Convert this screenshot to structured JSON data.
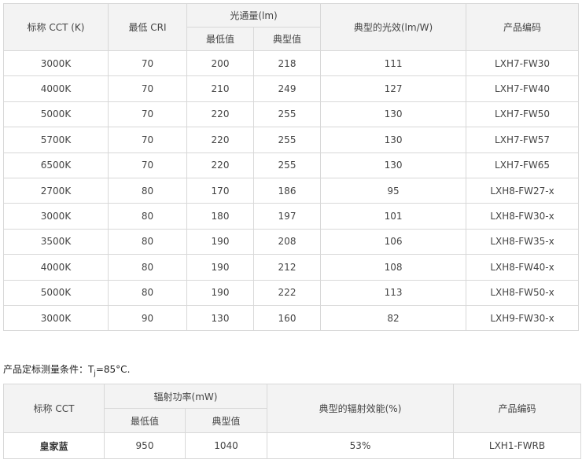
{
  "table1": {
    "headers": {
      "cct": "标称 CCT (K)",
      "min_cri": "最低 CRI",
      "flux_group": "光通量(lm)",
      "flux_min": "最低值",
      "flux_typ": "典型值",
      "efficacy": "典型的光效(lm/W)",
      "code": "产品编码"
    },
    "rows": [
      {
        "cct": "3000K",
        "cri": "70",
        "min": "200",
        "typ": "218",
        "eff": "111",
        "code": "LXH7-FW30"
      },
      {
        "cct": "4000K",
        "cri": "70",
        "min": "210",
        "typ": "249",
        "eff": "127",
        "code": "LXH7-FW40"
      },
      {
        "cct": "5000K",
        "cri": "70",
        "min": "220",
        "typ": "255",
        "eff": "130",
        "code": "LXH7-FW50"
      },
      {
        "cct": "5700K",
        "cri": "70",
        "min": "220",
        "typ": "255",
        "eff": "130",
        "code": "LXH7-FW57"
      },
      {
        "cct": "6500K",
        "cri": "70",
        "min": "220",
        "typ": "255",
        "eff": "130",
        "code": "LXH7-FW65"
      },
      {
        "cct": "2700K",
        "cri": "80",
        "min": "170",
        "typ": "186",
        "eff": "95",
        "code": "LXH8-FW27-x"
      },
      {
        "cct": "3000K",
        "cri": "80",
        "min": "180",
        "typ": "197",
        "eff": "101",
        "code": "LXH8-FW30-x"
      },
      {
        "cct": "3500K",
        "cri": "80",
        "min": "190",
        "typ": "208",
        "eff": "106",
        "code": "LXH8-FW35-x"
      },
      {
        "cct": "4000K",
        "cri": "80",
        "min": "190",
        "typ": "212",
        "eff": "108",
        "code": "LXH8-FW40-x"
      },
      {
        "cct": "5000K",
        "cri": "80",
        "min": "190",
        "typ": "222",
        "eff": "113",
        "code": "LXH8-FW50-x"
      },
      {
        "cct": "3000K",
        "cri": "90",
        "min": "130",
        "typ": "160",
        "eff": "82",
        "code": "LXH9-FW30-x"
      }
    ]
  },
  "caption": {
    "prefix": "产品定标测量条件：T",
    "subscript": "j",
    "suffix": "=85°C."
  },
  "table2": {
    "headers": {
      "cct": "标称 CCT",
      "power_group": "辐射功率(mW)",
      "power_min": "最低值",
      "power_typ": "典型值",
      "efficiency": "典型的辐射效能(%)",
      "code": "产品编码"
    },
    "rows": [
      {
        "cct": "皇家蓝",
        "min": "950",
        "typ": "1040",
        "eff": "53%",
        "code": "LXH1-FWRB"
      }
    ]
  }
}
